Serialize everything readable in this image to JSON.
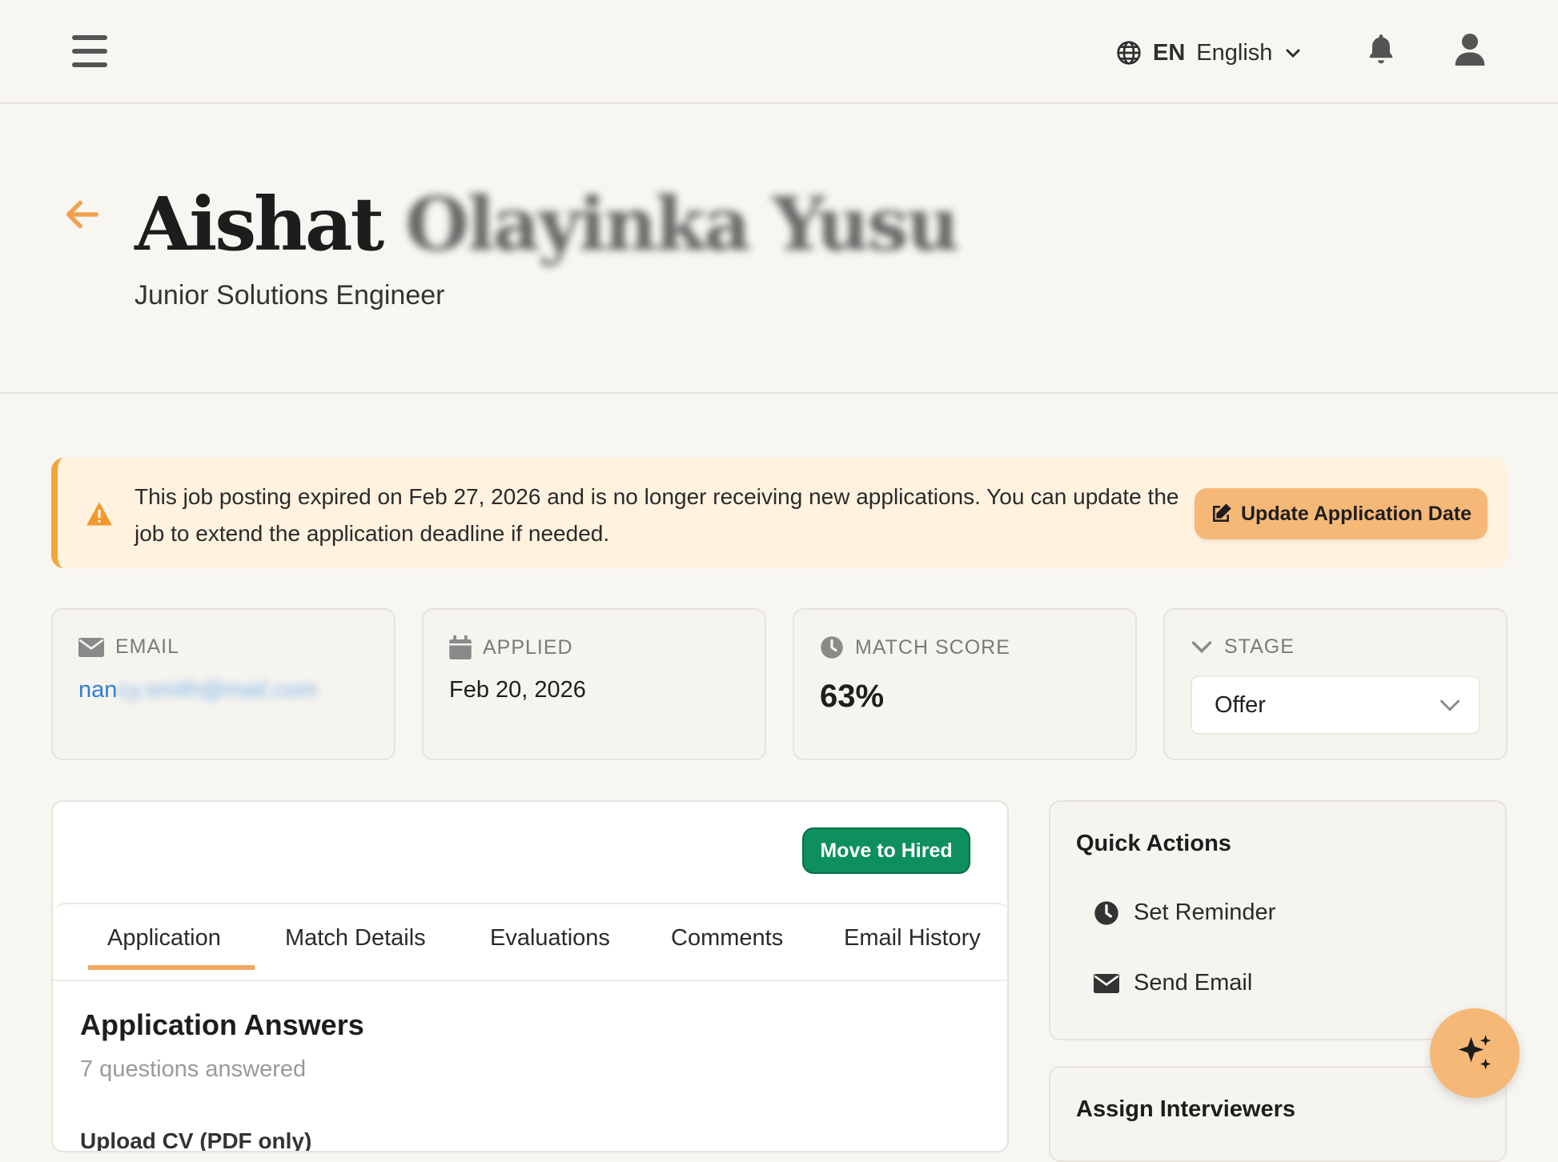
{
  "topbar": {
    "lang_code": "EN",
    "lang_name": "English"
  },
  "header": {
    "first_name": "Aishat",
    "last_name_blurred": "Olayinka Yusu",
    "job_title": "Junior Solutions Engineer"
  },
  "alert": {
    "message": "This job posting expired on Feb 27, 2026 and is no longer receiving new applications. You can update the job to extend the application deadline if needed.",
    "button_label": "Update Application Date"
  },
  "stats": {
    "email_label": "EMAIL",
    "email_visible": "nan",
    "email_blurred": "cy.smith@mail.com",
    "applied_label": "APPLIED",
    "applied_value": "Feb 20, 2026",
    "match_label": "MATCH SCORE",
    "match_value": "63%",
    "stage_label": "STAGE",
    "stage_value": "Offer"
  },
  "main": {
    "hired_button": "Move to Hired",
    "tabs": [
      {
        "label": "Application"
      },
      {
        "label": "Match Details"
      },
      {
        "label": "Evaluations"
      },
      {
        "label": "Comments"
      },
      {
        "label": "Email History"
      }
    ],
    "section_title": "Application Answers",
    "section_subtitle": "7 questions answered",
    "first_question_partial": "Upload CV (PDF only)"
  },
  "quick_actions": {
    "title": "Quick Actions",
    "items": [
      {
        "label": "Set Reminder",
        "icon": "clock-icon"
      },
      {
        "label": "Send Email",
        "icon": "envelope-icon"
      }
    ]
  },
  "assign": {
    "title": "Assign Interviewers"
  },
  "colors": {
    "accent": "#f6b877",
    "success": "#0d8f5e",
    "link": "#2f7fd6",
    "warning": "#f3a53e"
  }
}
